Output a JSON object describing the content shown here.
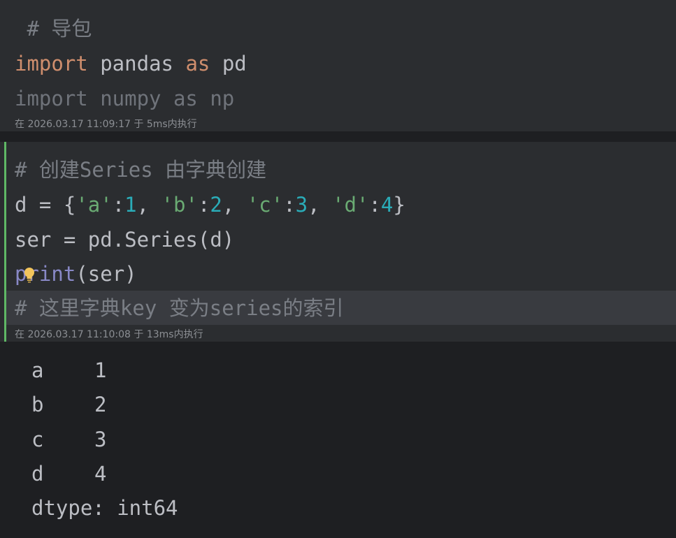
{
  "cell1": {
    "comment": " # 导包",
    "line2": {
      "kw1": "import",
      "mod": " pandas ",
      "kw2": "as",
      "alias": " pd"
    },
    "line3": "import numpy as np",
    "meta": "在 2026.03.17 11:09:17 于 5ms内执行"
  },
  "cell2": {
    "comment": "# 创建Series 由字典创建",
    "line2": {
      "p1": "d = {",
      "s1": "'a'",
      "c1": ":",
      "n1": "1",
      "sep1": ", ",
      "s2": "'b'",
      "c2": ":",
      "n2": "2",
      "sep2": ", ",
      "s3": "'c'",
      "c3": ":",
      "n3": "3",
      "sep3": ", ",
      "s4": "'d'",
      "c4": ":",
      "n4": "4",
      "end": "}"
    },
    "line3": "ser = pd.Series(d)",
    "line4": {
      "builtin": "print",
      "rest": "(ser)"
    },
    "line5": "# 这里字典key 变为series的索引",
    "meta": "在 2026.03.17 11:10:08 于 13ms内执行"
  },
  "output": {
    "rows": [
      {
        "index": "a",
        "value": "1"
      },
      {
        "index": "b",
        "value": "2"
      },
      {
        "index": "c",
        "value": "3"
      },
      {
        "index": "d",
        "value": "4"
      }
    ],
    "dtype": "dtype: int64"
  }
}
